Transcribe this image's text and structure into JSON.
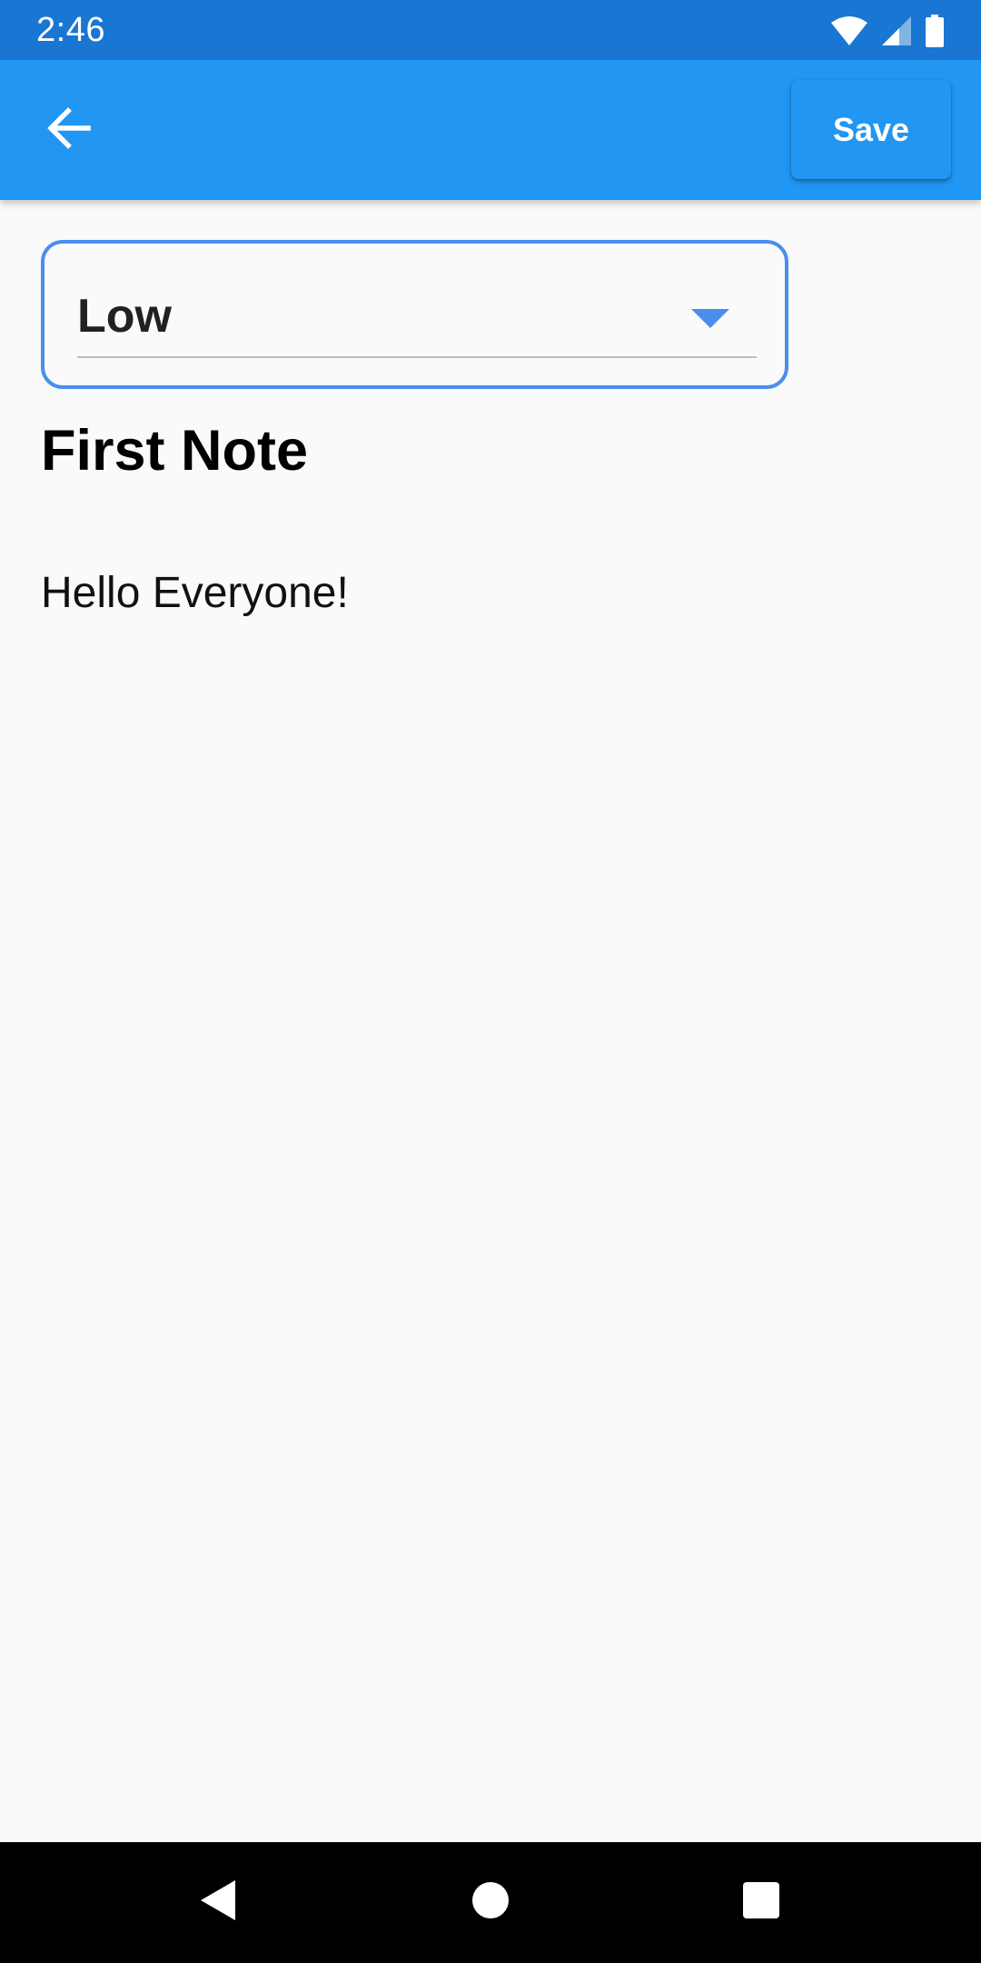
{
  "status_bar": {
    "time": "2:46",
    "icons": [
      "wifi-icon",
      "cellular-signal-icon",
      "battery-icon"
    ]
  },
  "app_bar": {
    "back_icon": "arrow-back-icon",
    "save_label": "Save",
    "color": "#2196f3"
  },
  "priority": {
    "selected": "Low",
    "accent": "#4a8eee"
  },
  "note": {
    "title": "First Note",
    "body": "Hello Everyone!"
  },
  "nav_bar": {
    "icons": [
      "back-triangle-icon",
      "home-circle-icon",
      "recents-square-icon"
    ]
  }
}
